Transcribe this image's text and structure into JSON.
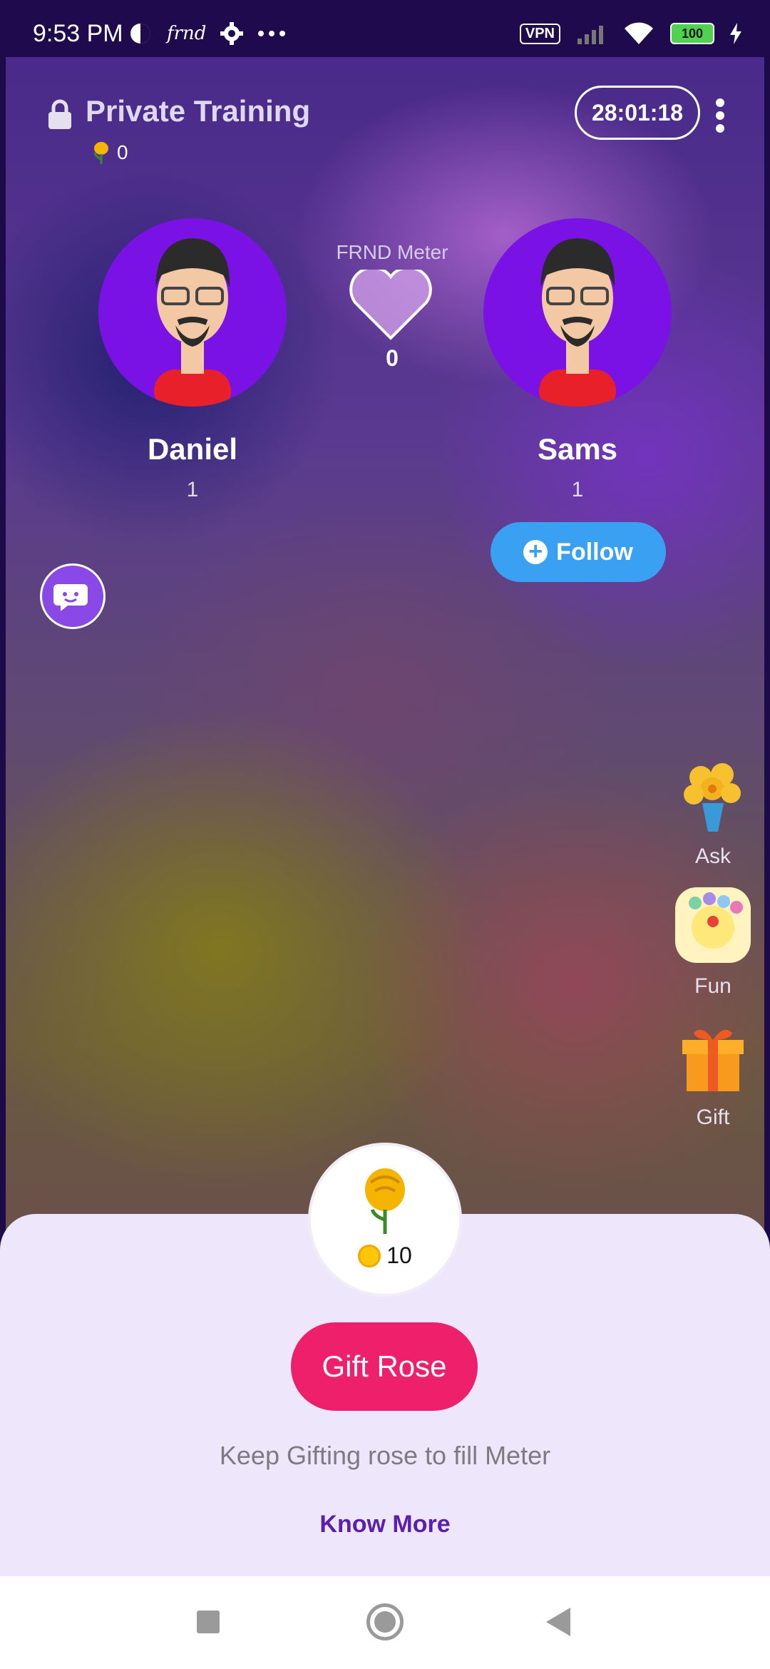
{
  "status_bar": {
    "time": "9:53 PM",
    "app_label": "frnd",
    "vpn": "VPN",
    "battery": "100"
  },
  "room": {
    "title": "Private Training",
    "rose_count": "0",
    "timer": "28:01:18"
  },
  "users": [
    {
      "name": "Daniel",
      "count": "1"
    },
    {
      "name": "Sams",
      "count": "1"
    }
  ],
  "meter": {
    "label": "FRND Meter",
    "value": "0"
  },
  "follow": {
    "label": "Follow"
  },
  "side_menu": [
    {
      "label": "Ask",
      "icon": "flower-bouquet-icon"
    },
    {
      "label": "Fun",
      "icon": "bubble-game-icon"
    },
    {
      "label": "Gift",
      "icon": "gift-box-icon"
    }
  ],
  "gift_panel": {
    "price": "10",
    "button_label": "Gift Rose",
    "hint": "Keep Gifting rose to fill Meter",
    "know_more": "Know More"
  },
  "colors": {
    "accent_pink": "#ee206c",
    "follow_blue": "#3aa0f2",
    "avatar_purple": "#7a12e6",
    "sheet_bg": "#eee6fa"
  }
}
